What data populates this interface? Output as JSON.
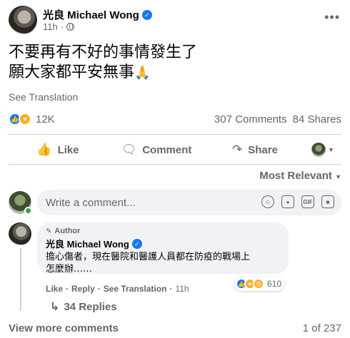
{
  "post": {
    "author": "光良 Michael Wong",
    "time": "11h",
    "text_line1": "不要再有不好的事情發生了",
    "text_line2": "願大家都平安無事",
    "see_translation": "See Translation"
  },
  "stats": {
    "reactions": "12K",
    "comments": "307 Comments",
    "shares": "84 Shares"
  },
  "actions": {
    "like": "Like",
    "comment": "Comment",
    "share": "Share"
  },
  "sort": {
    "label": "Most Relevant"
  },
  "compose": {
    "placeholder": "Write a comment..."
  },
  "comment": {
    "tag": "Author",
    "author": "光良 Michael Wong",
    "text_line1": "擔心傷者，現在醫院和醫護人員都在防疫的戰場上",
    "text_line2": "怎麼辦……",
    "like": "Like",
    "reply": "Reply",
    "see_translation": "See Translation",
    "time": "11h",
    "reactions": "610",
    "replies": "34 Replies"
  },
  "footer": {
    "view_more": "View more comments",
    "page": "1 of 237"
  },
  "colors": {
    "accent": "#1877f2",
    "secondary_text": "#65676b",
    "bubble": "#f0f2f5",
    "online": "#31a24c"
  },
  "icons": [
    "globe-icon",
    "more-icon",
    "verified-icon",
    "pray-icon",
    "like-reaction-icon",
    "care-reaction-icon",
    "sad-reaction-icon",
    "thumbs-up-icon",
    "comment-icon",
    "share-icon",
    "chevron-down-icon",
    "emoji-icon",
    "camera-icon",
    "gif-icon",
    "sticker-icon",
    "pen-icon",
    "reply-arrow-icon"
  ]
}
